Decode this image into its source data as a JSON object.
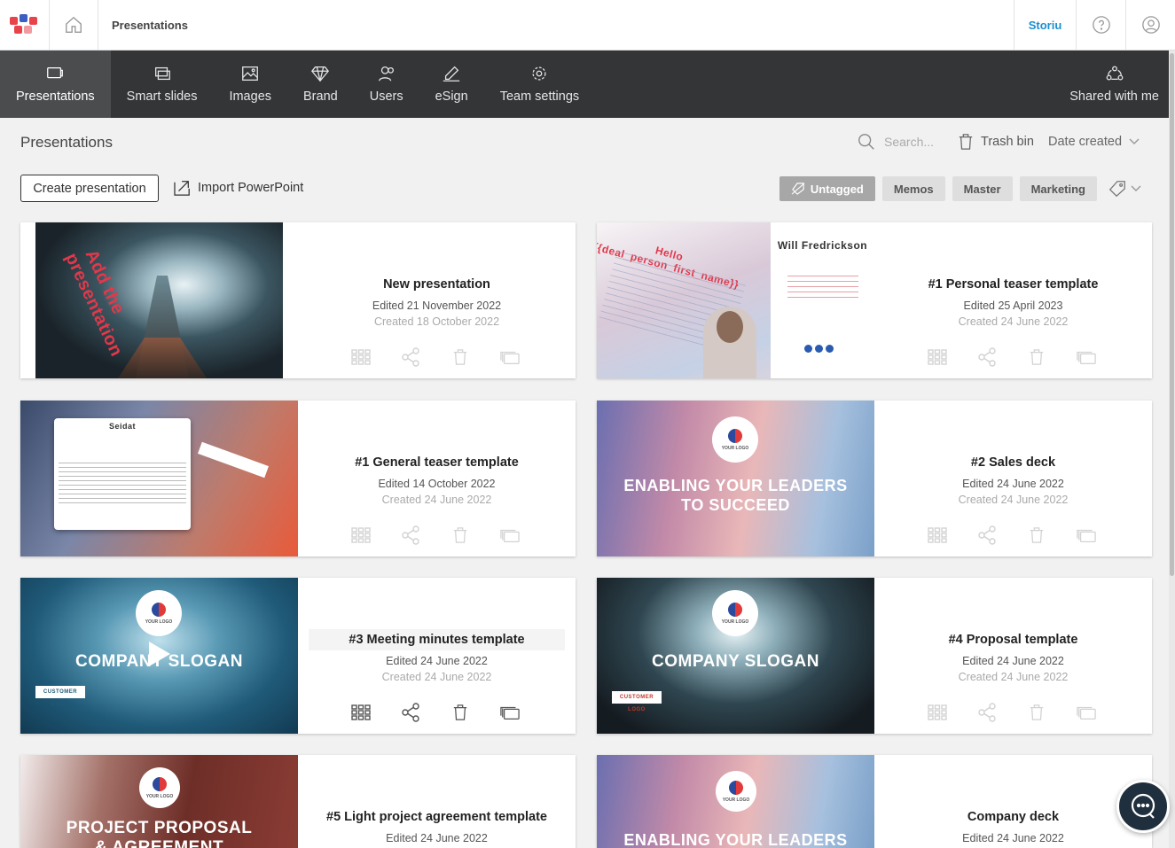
{
  "topbar": {
    "breadcrumb": "Presentations",
    "org_name": "Storiu"
  },
  "nav": {
    "items": [
      {
        "label": "Presentations",
        "icon": "presentation-icon"
      },
      {
        "label": "Smart slides",
        "icon": "slides-icon"
      },
      {
        "label": "Images",
        "icon": "image-icon"
      },
      {
        "label": "Brand",
        "icon": "diamond-icon"
      },
      {
        "label": "Users",
        "icon": "users-icon"
      },
      {
        "label": "eSign",
        "icon": "pen-icon"
      },
      {
        "label": "Team settings",
        "icon": "gear-icon"
      }
    ],
    "shared": "Shared with me"
  },
  "header": {
    "title": "Presentations",
    "search_placeholder": "Search...",
    "trash_label": "Trash bin",
    "sort_label": "Date created"
  },
  "actions": {
    "create": "Create presentation",
    "import": "Import PowerPoint"
  },
  "tags": [
    "Untagged",
    "Memos",
    "Master",
    "Marketing"
  ],
  "cards": [
    {
      "title": "New presentation",
      "edited": "Edited 21 November 2022",
      "created": "Created 18 October 2022",
      "slide_text": "Add the presentation"
    },
    {
      "title": "#1 Personal teaser template",
      "edited": "Edited 25 April 2023",
      "created": "Created 24 June 2022",
      "slide_name": "Will Fredrickson",
      "slide_greeting": "Hello {{deal_person_first_name}}"
    },
    {
      "title": "#1 General teaser template",
      "edited": "Edited 14 October 2022",
      "created": "Created 24 June 2022",
      "slide_brand": "Seidat"
    },
    {
      "title": "#2 Sales deck",
      "edited": "Edited 24 June 2022",
      "created": "Created 24 June 2022",
      "slide_line1": "ENABLING YOUR LEADERS",
      "slide_line2": "TO SUCCEED",
      "logo_text": "YOUR LOGO"
    },
    {
      "title": "#3 Meeting minutes template",
      "edited": "Edited 24 June 2022",
      "created": "Created 24 June 2022",
      "slide_line1": "COMPANY SLOGAN",
      "logo_text": "YOUR LOGO",
      "customer_logo": "CUSTOMER LOGO"
    },
    {
      "title": "#4 Proposal template",
      "edited": "Edited 24 June 2022",
      "created": "Created 24 June 2022",
      "slide_line1": "COMPANY SLOGAN",
      "logo_text": "YOUR LOGO",
      "customer_logo": "CUSTOMER LOGO"
    },
    {
      "title": "#5 Light project agreement template",
      "edited": "Edited 24 June 2022",
      "created": "",
      "slide_line1": "PROJECT PROPOSAL",
      "slide_line2": "& AGREEMENT",
      "logo_text": "YOUR LOGO"
    },
    {
      "title": "Company deck",
      "edited": "Edited 24 June 2022",
      "created": "",
      "slide_line1": "ENABLING YOUR LEADERS",
      "logo_text": "YOUR LOGO"
    }
  ]
}
